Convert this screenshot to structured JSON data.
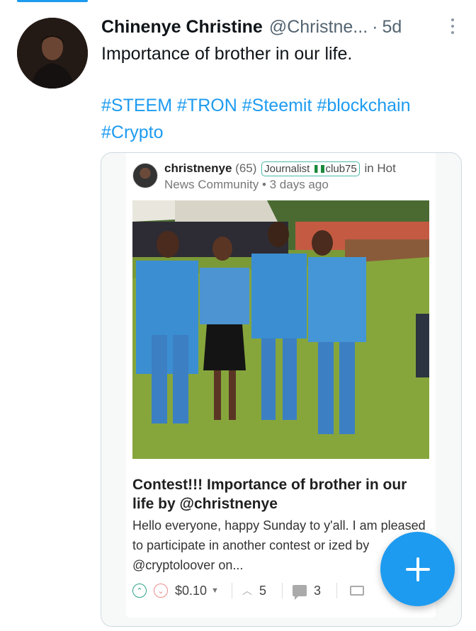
{
  "tweet": {
    "name": "Chinenye Christine",
    "handle": "@Christne...",
    "dot": "·",
    "time": "5d",
    "text": "Importance of brother in our life.",
    "hashtags": [
      "#STEEM",
      "#TRON",
      "#Steemit",
      "#blockchain",
      "#Crypto"
    ]
  },
  "card": {
    "author": "christnenye",
    "reputation": "(65)",
    "badge_left": "Journalist",
    "badge_right": "club75",
    "in_text": "in Hot",
    "community": "News Community",
    "bullet": "•",
    "age": "3 days ago",
    "title": "Contest!!! Importance of brother in our life by @christnenye",
    "excerpt": "Hello everyone, happy Sunday to y'all. I am pleased to participate in another contest or ized by @cryptoloover on...",
    "payout": "$0.10",
    "votes": "5",
    "comments": "3"
  },
  "colors": {
    "accent": "#1d9bf0",
    "upvote": "#2aa38a",
    "downvote": "#e98c8c"
  },
  "icons": [
    "more-icon",
    "upvote-icon",
    "downvote-icon",
    "caret-down-icon",
    "chevron-up-icon",
    "comment-icon",
    "share-icon",
    "plus-icon"
  ]
}
